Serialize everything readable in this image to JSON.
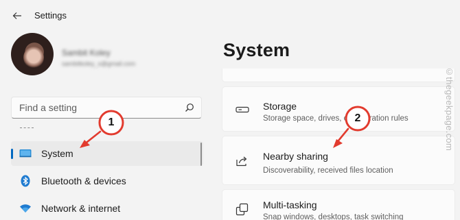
{
  "app": {
    "title": "Settings"
  },
  "profile": {
    "name": "Sambit Koley",
    "email": "sambitkoley_s@gmail.com"
  },
  "search": {
    "placeholder": "Find a setting"
  },
  "nav": {
    "items": [
      {
        "label": "System",
        "icon": "monitor-icon",
        "selected": true
      },
      {
        "label": "Bluetooth & devices",
        "icon": "bluetooth-icon"
      },
      {
        "label": "Network & internet",
        "icon": "wifi-icon"
      }
    ]
  },
  "main": {
    "title": "System",
    "cards": [
      {
        "title": "Storage",
        "desc": "Storage space, drives, configuration rules",
        "icon": "storage-drive-icon"
      },
      {
        "title": "Nearby sharing",
        "desc": "Discoverability, received files location",
        "icon": "share-icon"
      },
      {
        "title": "Multi-tasking",
        "desc": "Snap windows, desktops, task switching",
        "icon": "multitasking-icon"
      }
    ]
  },
  "watermark": "©thegeekpage.com",
  "annotations": {
    "badge1": "1",
    "badge2": "2",
    "color": "#e23b2e"
  },
  "colors": {
    "accent": "#0067c0",
    "background": "#f3f3f3",
    "card": "#fbfbfb"
  }
}
